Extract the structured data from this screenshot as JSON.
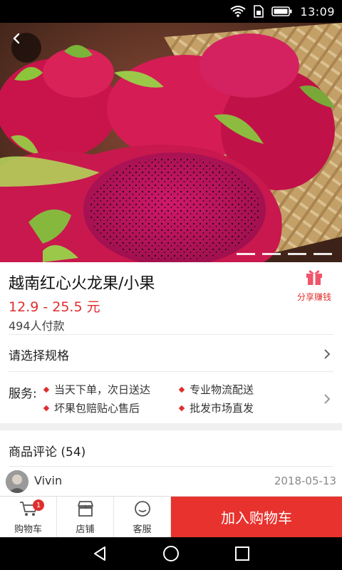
{
  "status_bar": {
    "time": "13:09",
    "icons": [
      "wifi-icon",
      "sim-icon",
      "battery-icon"
    ]
  },
  "hero": {
    "image": "dragon-fruit-photo",
    "carousel_pages": 4,
    "active_page": 1
  },
  "product": {
    "title": "越南红心火龙果/小果",
    "price": "12.9 - 25.5 元",
    "sold": "494人付款",
    "share_label": "分享赚钱"
  },
  "spec": {
    "label": "请选择规格"
  },
  "services": {
    "label": "服务:",
    "items": [
      "当天下单，次日送达",
      "专业物流配送",
      "坏果包赔贴心售后",
      "批发市场直发"
    ]
  },
  "reviews": {
    "title": "商品评论 (54)",
    "first": {
      "name": "Vivin",
      "date": "2018-05-13"
    }
  },
  "bottom_bar": {
    "cart_label": "购物车",
    "cart_badge": "1",
    "store_label": "店铺",
    "service_label": "客服",
    "add_to_cart": "加入购物车"
  },
  "colors": {
    "accent": "#e8322e",
    "price": "#e02e2e"
  }
}
